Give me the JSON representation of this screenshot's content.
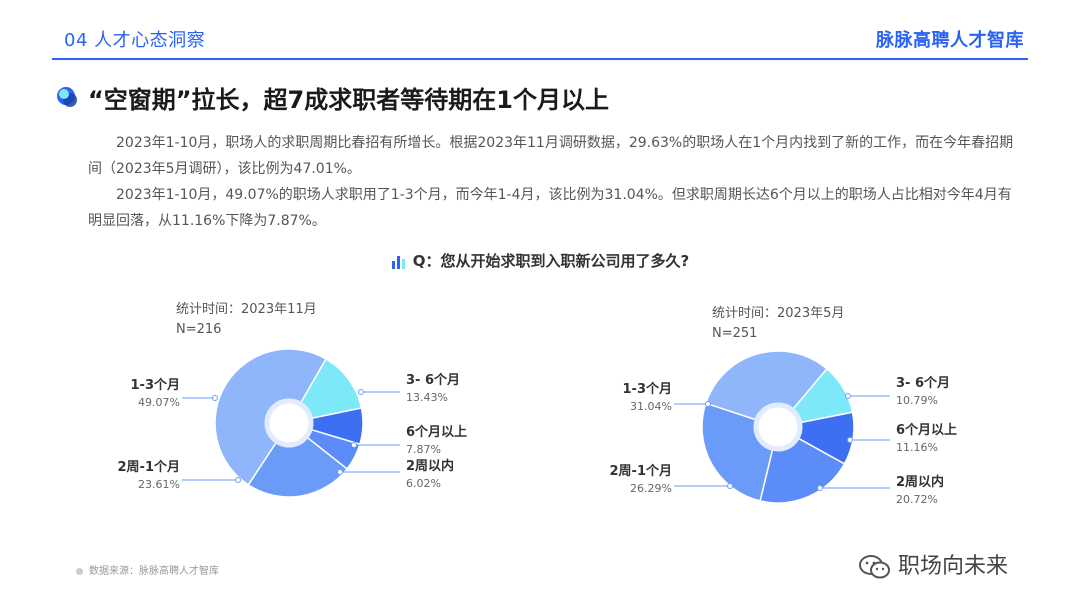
{
  "header": {
    "section": "04 人才心态洞察",
    "brand": "脉脉高聘人才智库"
  },
  "title": "“空窗期”拉长，超7成求职者等待期在1个月以上",
  "paragraphs": [
    "2023年1-10月，职场人的求职周期比春招有所增长。根据2023年11月调研数据，29.63%的职场人在1个月内找到了新的工作，而在今年春招期间（2023年5月调研），该比例为47.01%。",
    "2023年1-10月，49.07%的职场人求职用了1-3个月，而今年1-4月，该比例为31.04%。但求职周期长达6个月以上的职场人占比相对今年4月有明显回落，从11.16%下降为7.87%。"
  ],
  "question": "Q：您从开始求职到入职新公司用了多久?",
  "source": "数据来源：脉脉高聘人才智库",
  "watermark": "职场向未来",
  "colors": {
    "accent": "#2a63f5",
    "slice_1_3": "#8fb6fb",
    "slice_3_6": "#7de8f7",
    "slice_6plus": "#3c6ff1",
    "slice_2w": "#5b8cf7",
    "slice_2w_1m": "#6b9bf8"
  },
  "chart_data": [
    {
      "type": "pie",
      "meta_time": "统计时间：2023年11月",
      "meta_n": "N=216",
      "slices": [
        {
          "name": "1-3个月",
          "value": 49.07,
          "label": "49.07%",
          "color": "#8fb6fb"
        },
        {
          "name": "3- 6个月",
          "value": 13.43,
          "label": "13.43%",
          "color": "#7de8f7"
        },
        {
          "name": "6个月以上",
          "value": 7.87,
          "label": "7.87%",
          "color": "#3c6ff1"
        },
        {
          "name": "2周以内",
          "value": 6.02,
          "label": "6.02%",
          "color": "#5b8cf7"
        },
        {
          "name": "2周-1个月",
          "value": 23.61,
          "label": "23.61%",
          "color": "#6b9bf8"
        }
      ]
    },
    {
      "type": "pie",
      "meta_time": "统计时间：2023年5月",
      "meta_n": "N=251",
      "slices": [
        {
          "name": "1-3个月",
          "value": 31.04,
          "label": "31.04%",
          "color": "#8fb6fb"
        },
        {
          "name": "3- 6个月",
          "value": 10.79,
          "label": "10.79%",
          "color": "#7de8f7"
        },
        {
          "name": "6个月以上",
          "value": 11.16,
          "label": "11.16%",
          "color": "#3c6ff1"
        },
        {
          "name": "2周以内",
          "value": 20.72,
          "label": "20.72%",
          "color": "#5b8cf7"
        },
        {
          "name": "2周-1个月",
          "value": 26.29,
          "label": "26.29%",
          "color": "#6b9bf8"
        }
      ]
    }
  ]
}
